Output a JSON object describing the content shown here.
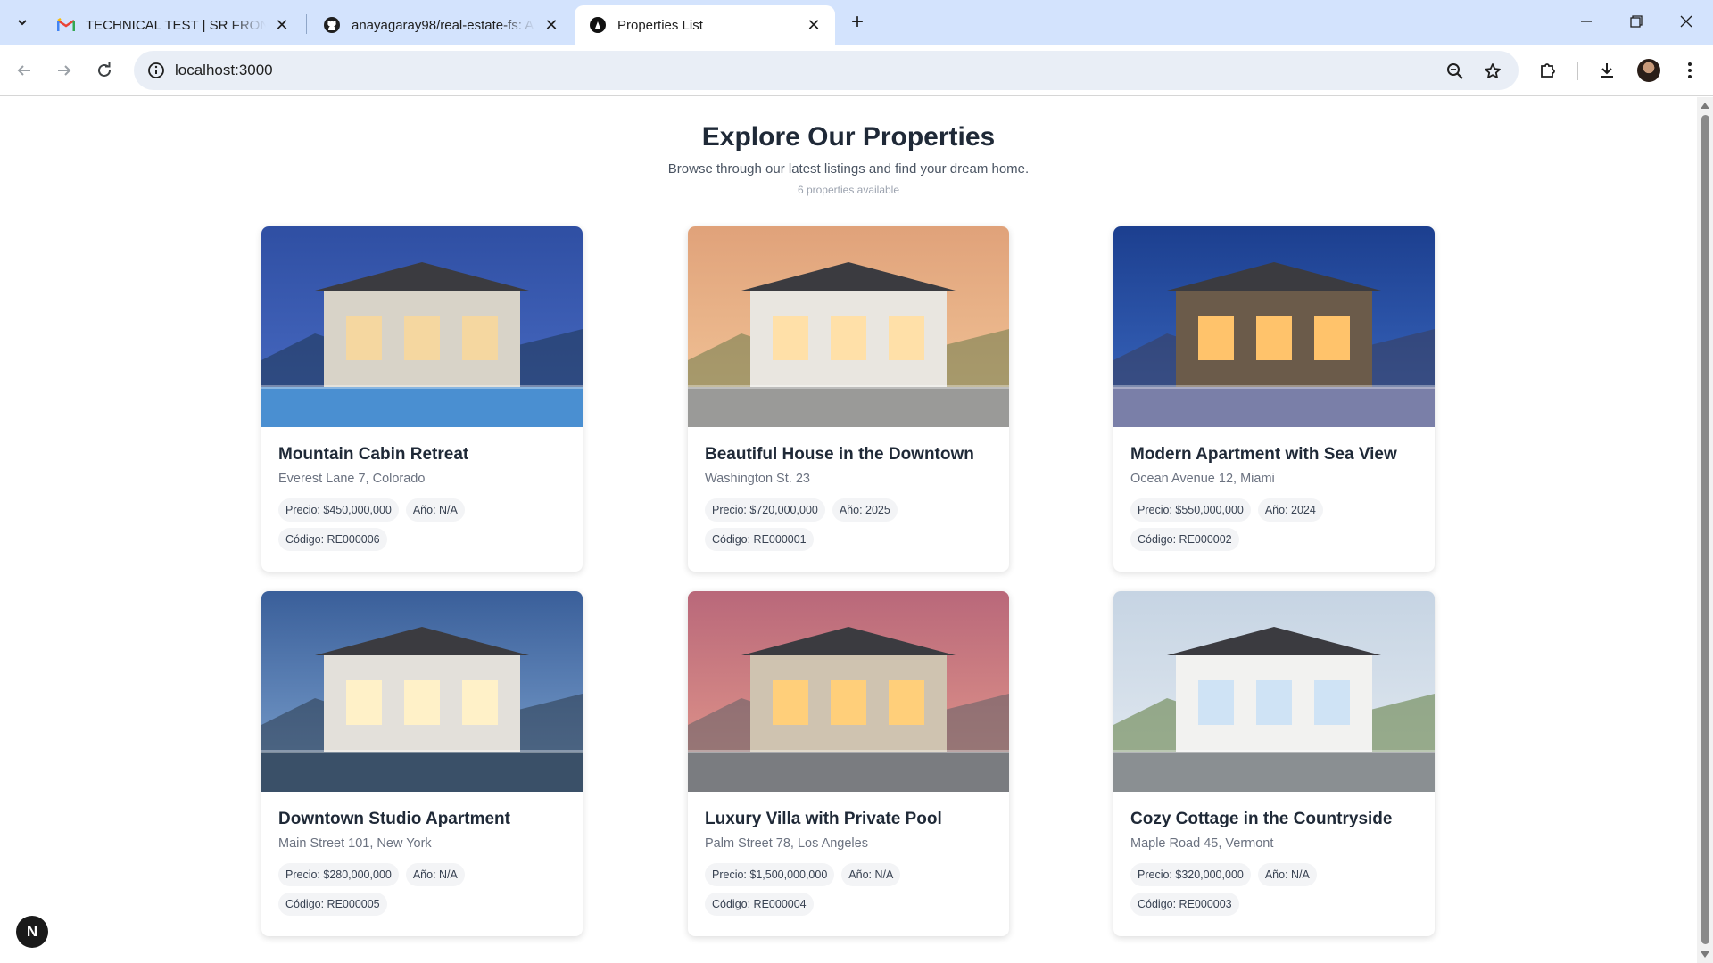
{
  "browser": {
    "tabs": [
      {
        "title": "TECHNICAL TEST | SR FRONTEN",
        "icon": "gmail-icon"
      },
      {
        "title": "anayagaray98/real-estate-fs: A",
        "icon": "github-icon"
      },
      {
        "title": "Properties List",
        "icon": "nextjs-icon",
        "active": true
      }
    ],
    "url": "localhost:3000"
  },
  "hero": {
    "title": "Explore Our Properties",
    "subtitle": "Browse through our latest listings and find your dream home.",
    "count": "6 properties available"
  },
  "properties": [
    {
      "title": "Mountain Cabin Retreat",
      "address": "Everest Lane 7, Colorado",
      "price": "Precio: $450,000,000",
      "year": "Año: N/A",
      "code": "Código: RE000006",
      "palette": "night-modern"
    },
    {
      "title": "Beautiful House in the Downtown",
      "address": "Washington St. 23",
      "price": "Precio: $720,000,000",
      "year": "Año: 2025",
      "code": "Código: RE000001",
      "palette": "sunset-mountain"
    },
    {
      "title": "Modern Apartment with Sea View",
      "address": "Ocean Avenue 12, Miami",
      "price": "Precio: $550,000,000",
      "year": "Año: 2024",
      "code": "Código: RE000002",
      "palette": "dusk-villa"
    },
    {
      "title": "Downtown Studio Apartment",
      "address": "Main Street 101, New York",
      "price": "Precio: $280,000,000",
      "year": "Año: N/A",
      "code": "Código: RE000005",
      "palette": "blue-modern"
    },
    {
      "title": "Luxury Villa with Private Pool",
      "address": "Palm Street 78, Los Angeles",
      "price": "Precio: $1,500,000,000",
      "year": "Año: N/A",
      "code": "Código: RE000004",
      "palette": "pink-sunset"
    },
    {
      "title": "Cozy Cottage in the Countryside",
      "address": "Maple Road 45, Vermont",
      "price": "Precio: $320,000,000",
      "year": "Año: N/A",
      "code": "Código: RE000003",
      "palette": "day-modern"
    }
  ],
  "badge": "N"
}
